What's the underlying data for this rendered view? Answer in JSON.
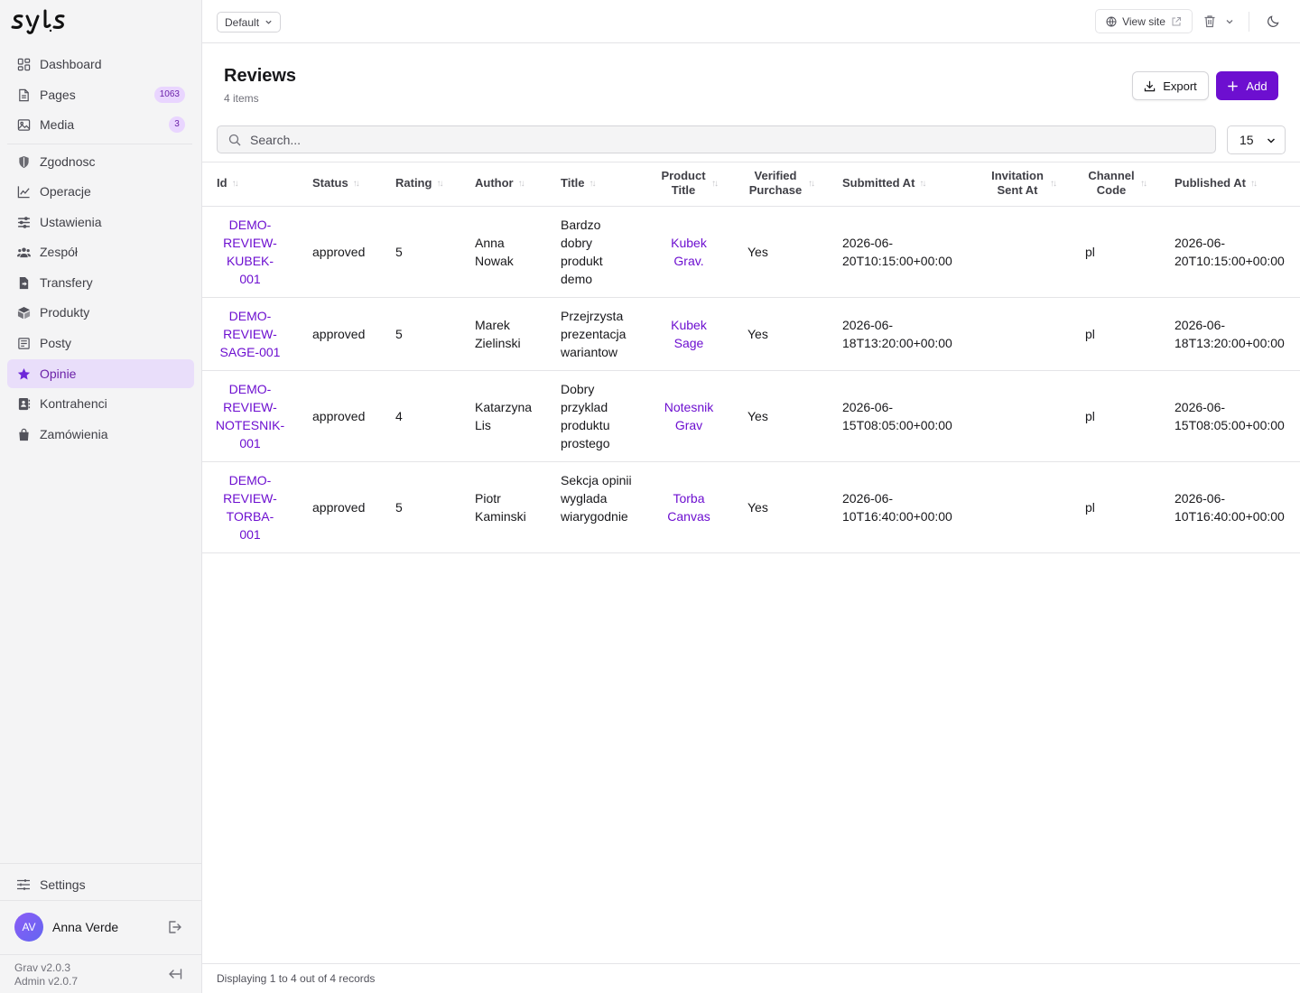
{
  "sidebar": {
    "logo_icon": "syls-logo",
    "items": [
      {
        "label": "Dashboard",
        "icon": "dashboard-icon"
      },
      {
        "label": "Pages",
        "icon": "file-icon",
        "badge": "1063"
      },
      {
        "label": "Media",
        "icon": "image-icon",
        "badge": "3"
      },
      {
        "label": "Zgodnosc",
        "icon": "shield-icon"
      },
      {
        "label": "Operacje",
        "icon": "chart-line-icon"
      },
      {
        "label": "Ustawienia",
        "icon": "sliders-icon"
      },
      {
        "label": "Zespół",
        "icon": "users-icon"
      },
      {
        "label": "Transfery",
        "icon": "file-transfer-icon"
      },
      {
        "label": "Produkty",
        "icon": "box-icon"
      },
      {
        "label": "Posty",
        "icon": "newspaper-icon"
      },
      {
        "label": "Opinie",
        "icon": "star-icon",
        "active": true
      },
      {
        "label": "Kontrahenci",
        "icon": "address-book-icon"
      },
      {
        "label": "Zamówienia",
        "icon": "shopping-bag-icon"
      }
    ],
    "settings_label": "Settings",
    "user": {
      "initials": "AV",
      "name": "Anna Verde"
    },
    "version_grav": "Grav v2.0.3",
    "version_admin": "Admin v2.0.7"
  },
  "topbar": {
    "environment": "Default",
    "view_site": "View site"
  },
  "header": {
    "title": "Reviews",
    "subtitle": "4 items",
    "export_label": "Export",
    "add_label": "Add"
  },
  "search": {
    "placeholder": "Search...",
    "per_page": "15"
  },
  "table": {
    "columns": [
      "Id",
      "Status",
      "Rating",
      "Author",
      "Title",
      "Product Title",
      "Verified Purchase",
      "Submitted At",
      "Invitation Sent At",
      "Channel Code",
      "Published At"
    ],
    "rows": [
      {
        "id": "DEMO-REVIEW-KUBEK-001",
        "status": "approved",
        "rating": "5",
        "author": "Anna Nowak",
        "title": "Bardzo dobry produkt demo",
        "product_title": "Kubek Grav.",
        "verified": "Yes",
        "submitted_at": "2026-06-20T10:15:00+00:00",
        "invitation_sent_at": "",
        "channel_code": "pl",
        "published_at": "2026-06-20T10:15:00+00:00"
      },
      {
        "id": "DEMO-REVIEW-SAGE-001",
        "status": "approved",
        "rating": "5",
        "author": "Marek Zielinski",
        "title": "Przejrzysta prezentacja wariantow",
        "product_title": "Kubek Sage",
        "verified": "Yes",
        "submitted_at": "2026-06-18T13:20:00+00:00",
        "invitation_sent_at": "",
        "channel_code": "pl",
        "published_at": "2026-06-18T13:20:00+00:00"
      },
      {
        "id": "DEMO-REVIEW-NOTESNIK-001",
        "status": "approved",
        "rating": "4",
        "author": "Katarzyna Lis",
        "title": "Dobry przyklad produktu prostego",
        "product_title": "Notesnik Grav",
        "verified": "Yes",
        "submitted_at": "2026-06-15T08:05:00+00:00",
        "invitation_sent_at": "",
        "channel_code": "pl",
        "published_at": "2026-06-15T08:05:00+00:00"
      },
      {
        "id": "DEMO-REVIEW-TORBA-001",
        "status": "approved",
        "rating": "5",
        "author": "Piotr Kaminski",
        "title": "Sekcja opinii wyglada wiarygodnie",
        "product_title": "Torba Canvas",
        "verified": "Yes",
        "submitted_at": "2026-06-10T16:40:00+00:00",
        "invitation_sent_at": "",
        "channel_code": "pl",
        "published_at": "2026-06-10T16:40:00+00:00"
      }
    ]
  },
  "footer": {
    "text": "Displaying 1 to 4 out of 4 records"
  },
  "colors": {
    "accent": "#6d0fd0",
    "active_bg": "#e9defa",
    "sidebar_bg": "#f4f4f5"
  }
}
